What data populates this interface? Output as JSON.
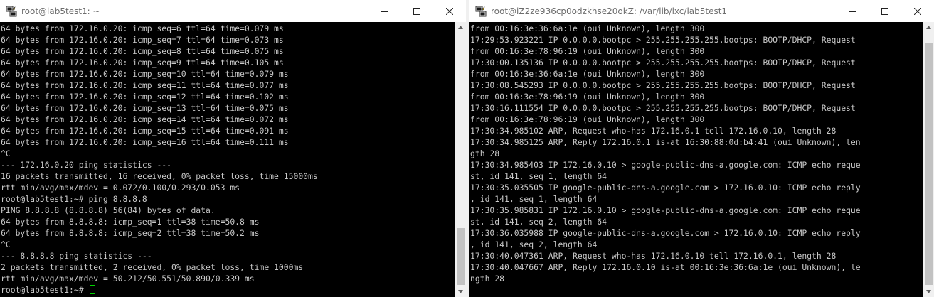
{
  "windows": [
    {
      "title": "root@lab5test1: ~",
      "icon": "putty-icon",
      "lines": [
        "64 bytes from 172.16.0.20: icmp_seq=6 ttl=64 time=0.079 ms",
        "64 bytes from 172.16.0.20: icmp_seq=7 ttl=64 time=0.073 ms",
        "64 bytes from 172.16.0.20: icmp_seq=8 ttl=64 time=0.075 ms",
        "64 bytes from 172.16.0.20: icmp_seq=9 ttl=64 time=0.105 ms",
        "64 bytes from 172.16.0.20: icmp_seq=10 ttl=64 time=0.079 ms",
        "64 bytes from 172.16.0.20: icmp_seq=11 ttl=64 time=0.077 ms",
        "64 bytes from 172.16.0.20: icmp_seq=12 ttl=64 time=0.102 ms",
        "64 bytes from 172.16.0.20: icmp_seq=13 ttl=64 time=0.075 ms",
        "64 bytes from 172.16.0.20: icmp_seq=14 ttl=64 time=0.072 ms",
        "64 bytes from 172.16.0.20: icmp_seq=15 ttl=64 time=0.091 ms",
        "64 bytes from 172.16.0.20: icmp_seq=16 ttl=64 time=0.111 ms",
        "^C",
        "--- 172.16.0.20 ping statistics ---",
        "16 packets transmitted, 16 received, 0% packet loss, time 15000ms",
        "rtt min/avg/max/mdev = 0.072/0.100/0.293/0.053 ms",
        "root@lab5test1:~# ping 8.8.8.8",
        "PING 8.8.8.8 (8.8.8.8) 56(84) bytes of data.",
        "64 bytes from 8.8.8.8: icmp_seq=1 ttl=38 time=50.8 ms",
        "64 bytes from 8.8.8.8: icmp_seq=2 ttl=38 time=50.2 ms",
        "^C",
        "--- 8.8.8.8 ping statistics ---",
        "2 packets transmitted, 2 received, 0% packet loss, time 1000ms",
        "rtt min/avg/max/mdev = 50.212/50.551/50.890/0.339 ms"
      ],
      "prompt": "root@lab5test1:~# "
    },
    {
      "title": "root@iZ2ze936cp0odzkhse20okZ: /var/lib/lxc/lab5test1",
      "icon": "putty-icon",
      "lines": [
        "from 00:16:3e:36:6a:1e (oui Unknown), length 300",
        "17:29:53.923221 IP 0.0.0.0.bootpc > 255.255.255.255.bootps: BOOTP/DHCP, Request",
        "from 00:16:3e:78:96:19 (oui Unknown), length 300",
        "17:30:00.135136 IP 0.0.0.0.bootpc > 255.255.255.255.bootps: BOOTP/DHCP, Request",
        "from 00:16:3e:36:6a:1e (oui Unknown), length 300",
        "17:30:08.545293 IP 0.0.0.0.bootpc > 255.255.255.255.bootps: BOOTP/DHCP, Request",
        "from 00:16:3e:78:96:19 (oui Unknown), length 300",
        "17:30:16.111554 IP 0.0.0.0.bootpc > 255.255.255.255.bootps: BOOTP/DHCP, Request",
        "from 00:16:3e:78:96:19 (oui Unknown), length 300",
        "17:30:34.985102 ARP, Request who-has 172.16.0.1 tell 172.16.0.10, length 28",
        "17:30:34.985125 ARP, Reply 172.16.0.1 is-at 16:30:88:0d:b4:41 (oui Unknown), len",
        "gth 28",
        "17:30:34.985403 IP 172.16.0.10 > google-public-dns-a.google.com: ICMP echo reque",
        "st, id 141, seq 1, length 64",
        "17:30:35.035505 IP google-public-dns-a.google.com > 172.16.0.10: ICMP echo reply",
        ", id 141, seq 1, length 64",
        "17:30:35.985831 IP 172.16.0.10 > google-public-dns-a.google.com: ICMP echo reque",
        "st, id 141, seq 2, length 64",
        "17:30:36.035988 IP google-public-dns-a.google.com > 172.16.0.10: ICMP echo reply",
        ", id 141, seq 2, length 64",
        "17:30:40.047361 ARP, Request who-has 172.16.0.10 tell 172.16.0.1, length 28",
        "17:30:40.047667 ARP, Reply 172.16.0.10 is-at 00:16:3e:36:6a:1e (oui Unknown), le",
        "ngth 28"
      ],
      "prompt": ""
    }
  ],
  "colors": {
    "terminal_bg": "#000000",
    "terminal_fg": "#c8c8c8",
    "cursor": "#00d000",
    "titlebar_bg": "#ffffff",
    "title_text": "#6d6d6d"
  }
}
